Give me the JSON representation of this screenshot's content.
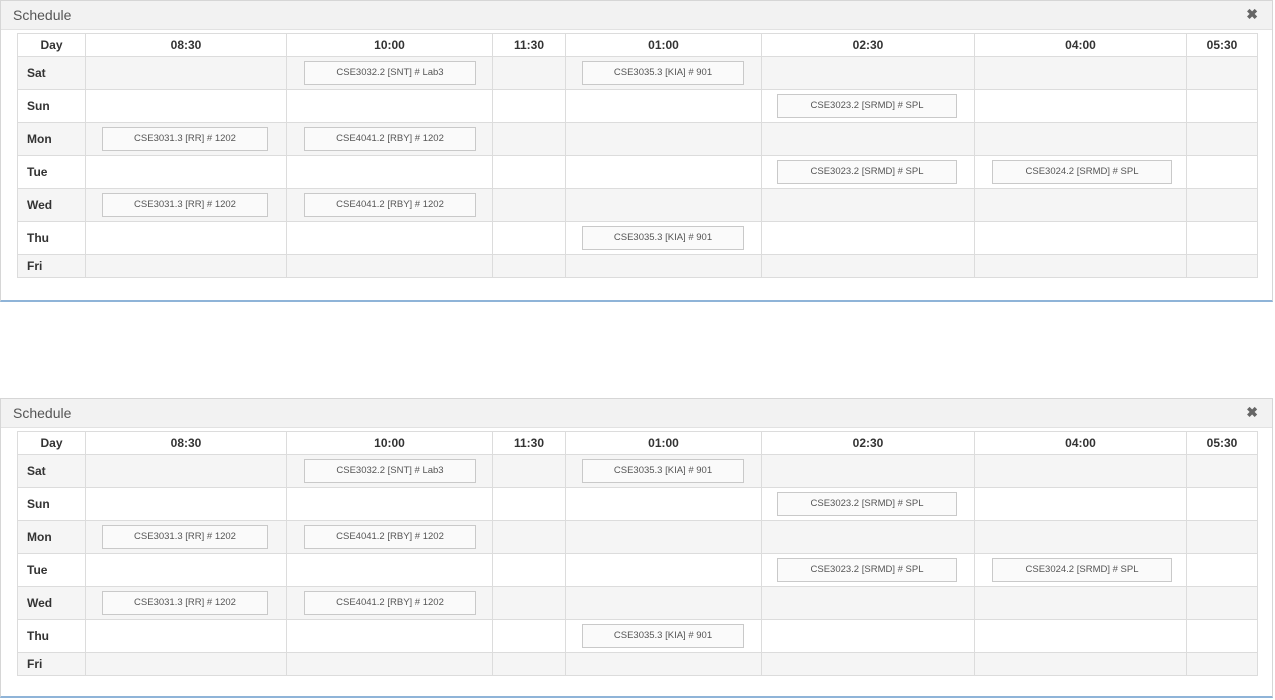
{
  "panels": [
    {
      "title": "Schedule",
      "close_glyph": "✖",
      "columns": [
        "Day",
        "08:30",
        "10:00",
        "11:30",
        "01:00",
        "02:30",
        "04:00",
        "05:30"
      ],
      "rows": [
        {
          "day": "Sat",
          "slots": [
            "",
            "CSE3032.2 [SNT] # Lab3",
            "",
            "CSE3035.3 [KIA] # 901",
            "",
            "",
            ""
          ]
        },
        {
          "day": "Sun",
          "slots": [
            "",
            "",
            "",
            "",
            "CSE3023.2 [SRMD] # SPL",
            "",
            ""
          ]
        },
        {
          "day": "Mon",
          "slots": [
            "CSE3031.3 [RR] # 1202",
            "CSE4041.2 [RBY] # 1202",
            "",
            "",
            "",
            "",
            ""
          ]
        },
        {
          "day": "Tue",
          "slots": [
            "",
            "",
            "",
            "",
            "CSE3023.2 [SRMD] # SPL",
            "CSE3024.2 [SRMD] # SPL",
            ""
          ]
        },
        {
          "day": "Wed",
          "slots": [
            "CSE3031.3 [RR] # 1202",
            "CSE4041.2 [RBY] # 1202",
            "",
            "",
            "",
            "",
            ""
          ]
        },
        {
          "day": "Thu",
          "slots": [
            "",
            "",
            "",
            "CSE3035.3 [KIA] # 901",
            "",
            "",
            ""
          ]
        },
        {
          "day": "Fri",
          "slots": [
            "",
            "",
            "",
            "",
            "",
            "",
            ""
          ]
        }
      ]
    },
    {
      "title": "Schedule",
      "close_glyph": "✖",
      "columns": [
        "Day",
        "08:30",
        "10:00",
        "11:30",
        "01:00",
        "02:30",
        "04:00",
        "05:30"
      ],
      "rows": [
        {
          "day": "Sat",
          "slots": [
            "",
            "CSE3032.2 [SNT] # Lab3",
            "",
            "CSE3035.3 [KIA] # 901",
            "",
            "",
            ""
          ]
        },
        {
          "day": "Sun",
          "slots": [
            "",
            "",
            "",
            "",
            "CSE3023.2 [SRMD] # SPL",
            "",
            ""
          ]
        },
        {
          "day": "Mon",
          "slots": [
            "CSE3031.3 [RR] # 1202",
            "CSE4041.2 [RBY] # 1202",
            "",
            "",
            "",
            "",
            ""
          ]
        },
        {
          "day": "Tue",
          "slots": [
            "",
            "",
            "",
            "",
            "CSE3023.2 [SRMD] # SPL",
            "CSE3024.2 [SRMD] # SPL",
            ""
          ]
        },
        {
          "day": "Wed",
          "slots": [
            "CSE3031.3 [RR] # 1202",
            "CSE4041.2 [RBY] # 1202",
            "",
            "",
            "",
            "",
            ""
          ]
        },
        {
          "day": "Thu",
          "slots": [
            "",
            "",
            "",
            "CSE3035.3 [KIA] # 901",
            "",
            "",
            ""
          ]
        },
        {
          "day": "Fri",
          "slots": [
            "",
            "",
            "",
            "",
            "",
            "",
            ""
          ]
        }
      ]
    }
  ]
}
